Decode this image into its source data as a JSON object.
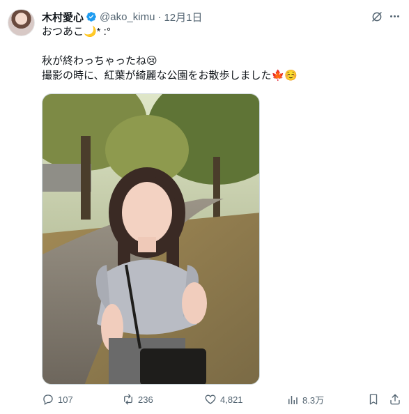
{
  "tweet": {
    "display_name": "木村愛心",
    "handle": "@ako_kimu",
    "separator": "·",
    "date": "12月1日",
    "lines": [
      "おつあこ🌙* :°",
      "",
      "秋が終わっちゃったね😢",
      "撮影の時に、紅葉が綺麗な公園をお散歩しました🍁☺️"
    ]
  },
  "stats": {
    "replies": "107",
    "retweets": "236",
    "likes": "4,821",
    "views": "8.3万"
  },
  "icons": {
    "verified": "verified-badge-icon",
    "grok": "grok-icon",
    "more": "more-icon",
    "reply": "reply-icon",
    "retweet": "retweet-icon",
    "like": "heart-icon",
    "views": "views-icon",
    "bookmark": "bookmark-icon",
    "share": "share-icon"
  },
  "colors": {
    "text": "#0f1419",
    "secondary": "#536471",
    "verified": "#1d9bf0"
  }
}
